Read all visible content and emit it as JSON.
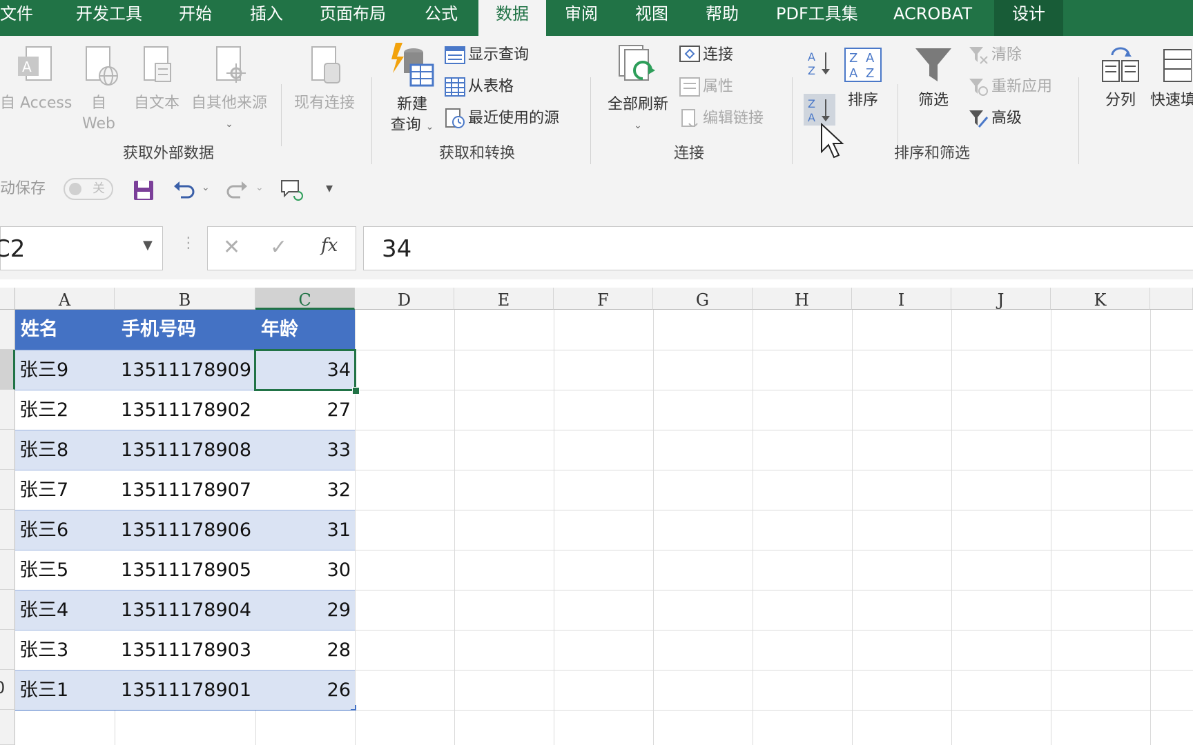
{
  "tabs": [
    {
      "label": "文件"
    },
    {
      "label": "开发工具"
    },
    {
      "label": "开始"
    },
    {
      "label": "插入"
    },
    {
      "label": "页面布局"
    },
    {
      "label": "公式"
    },
    {
      "label": "数据"
    },
    {
      "label": "审阅"
    },
    {
      "label": "视图"
    },
    {
      "label": "帮助"
    },
    {
      "label": "PDF工具集"
    },
    {
      "label": "ACROBAT"
    },
    {
      "label": "设计"
    }
  ],
  "ribbon": {
    "get_external": {
      "label": "获取外部数据",
      "access": "自 Access",
      "web_line1": "自",
      "web_line2": "Web",
      "text": "自文本",
      "other": "自其他来源",
      "existing": "现有连接"
    },
    "get_transform": {
      "label": "获取和转换",
      "new_query_line1": "新建",
      "new_query_line2": "查询",
      "show_query": "显示查询",
      "from_table": "从表格",
      "recent_sources": "最近使用的源"
    },
    "connections": {
      "label": "连接",
      "refresh_all": "全部刷新",
      "connections": "连接",
      "properties": "属性",
      "edit_links": "编辑链接"
    },
    "sort_filter": {
      "label": "排序和筛选",
      "sort": "排序",
      "filter": "筛选",
      "clear": "清除",
      "reapply": "重新应用",
      "advanced": "高级"
    },
    "tools": {
      "text_to_columns": "分列",
      "flash_fill": "快速填"
    }
  },
  "qat": {
    "autosave": "动保存",
    "toggle": "关"
  },
  "formula_bar": {
    "name_box": "C2",
    "value": "34"
  },
  "columns": [
    "A",
    "B",
    "C",
    "D",
    "E",
    "F",
    "G",
    "H",
    "I",
    "J",
    "K"
  ],
  "table": {
    "headers": [
      "姓名",
      "手机号码",
      "年龄"
    ],
    "rows": [
      {
        "name": "张三9",
        "phone": "13511178909",
        "age": "34"
      },
      {
        "name": "张三2",
        "phone": "13511178902",
        "age": "27"
      },
      {
        "name": "张三8",
        "phone": "13511178908",
        "age": "33"
      },
      {
        "name": "张三7",
        "phone": "13511178907",
        "age": "32"
      },
      {
        "name": "张三6",
        "phone": "13511178906",
        "age": "31"
      },
      {
        "name": "张三5",
        "phone": "13511178905",
        "age": "30"
      },
      {
        "name": "张三4",
        "phone": "13511178904",
        "age": "29"
      },
      {
        "name": "张三3",
        "phone": "13511178903",
        "age": "28"
      },
      {
        "name": "张三1",
        "phone": "13511178901",
        "age": "26"
      }
    ]
  },
  "row_numbers_visible": [
    "0"
  ],
  "colors": {
    "excel_green": "#217346",
    "table_header": "#4472c4",
    "table_band": "#dae3f3"
  }
}
